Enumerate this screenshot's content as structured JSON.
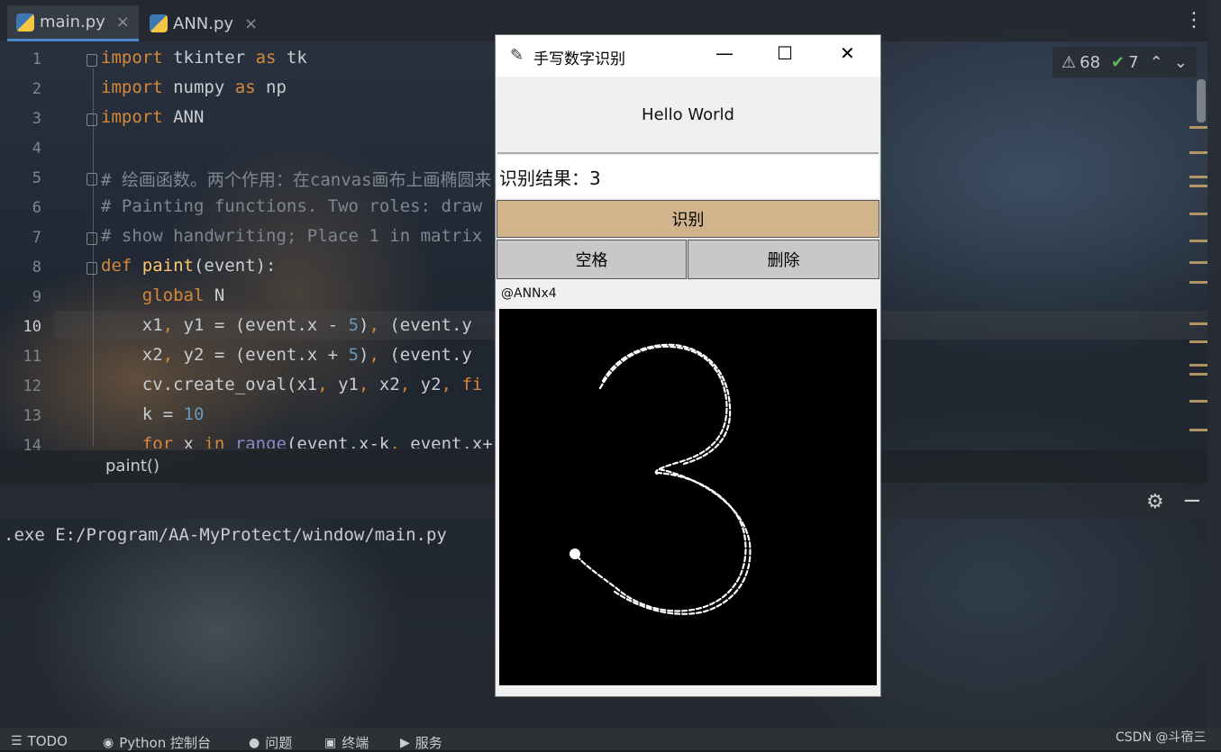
{
  "ide": {
    "tabs": [
      {
        "label": "main.py",
        "active": true
      },
      {
        "label": "ANN.py",
        "active": false
      }
    ],
    "tab_close_glyph": "×",
    "inspections": {
      "warnings": "68",
      "ok": "7"
    },
    "line_numbers": [
      "1",
      "2",
      "3",
      "4",
      "5",
      "6",
      "7",
      "8",
      "9",
      "10",
      "11",
      "12",
      "13",
      "14"
    ],
    "breadcrumb": "paint()",
    "console_line": ".exe E:/Program/AA-MyProtect/window/main.py"
  },
  "statusbar": {
    "items": [
      "TODO",
      "Python 控制台",
      "问题",
      "终端",
      "服务"
    ],
    "watermark": "CSDN @斗宿三"
  },
  "tk": {
    "title": "手写数字识别",
    "hello": "Hello World",
    "result": "识别结果：3",
    "recognize_button": "识别",
    "space_button": "空格",
    "delete_button": "删除",
    "credit": "@ANNx4",
    "drawn_digit": "3"
  },
  "colors": {
    "recognize_button_bg": "#d2b48c",
    "canvas_bg": "#000000",
    "keyword": "#d68738",
    "comment": "#7f8690"
  }
}
